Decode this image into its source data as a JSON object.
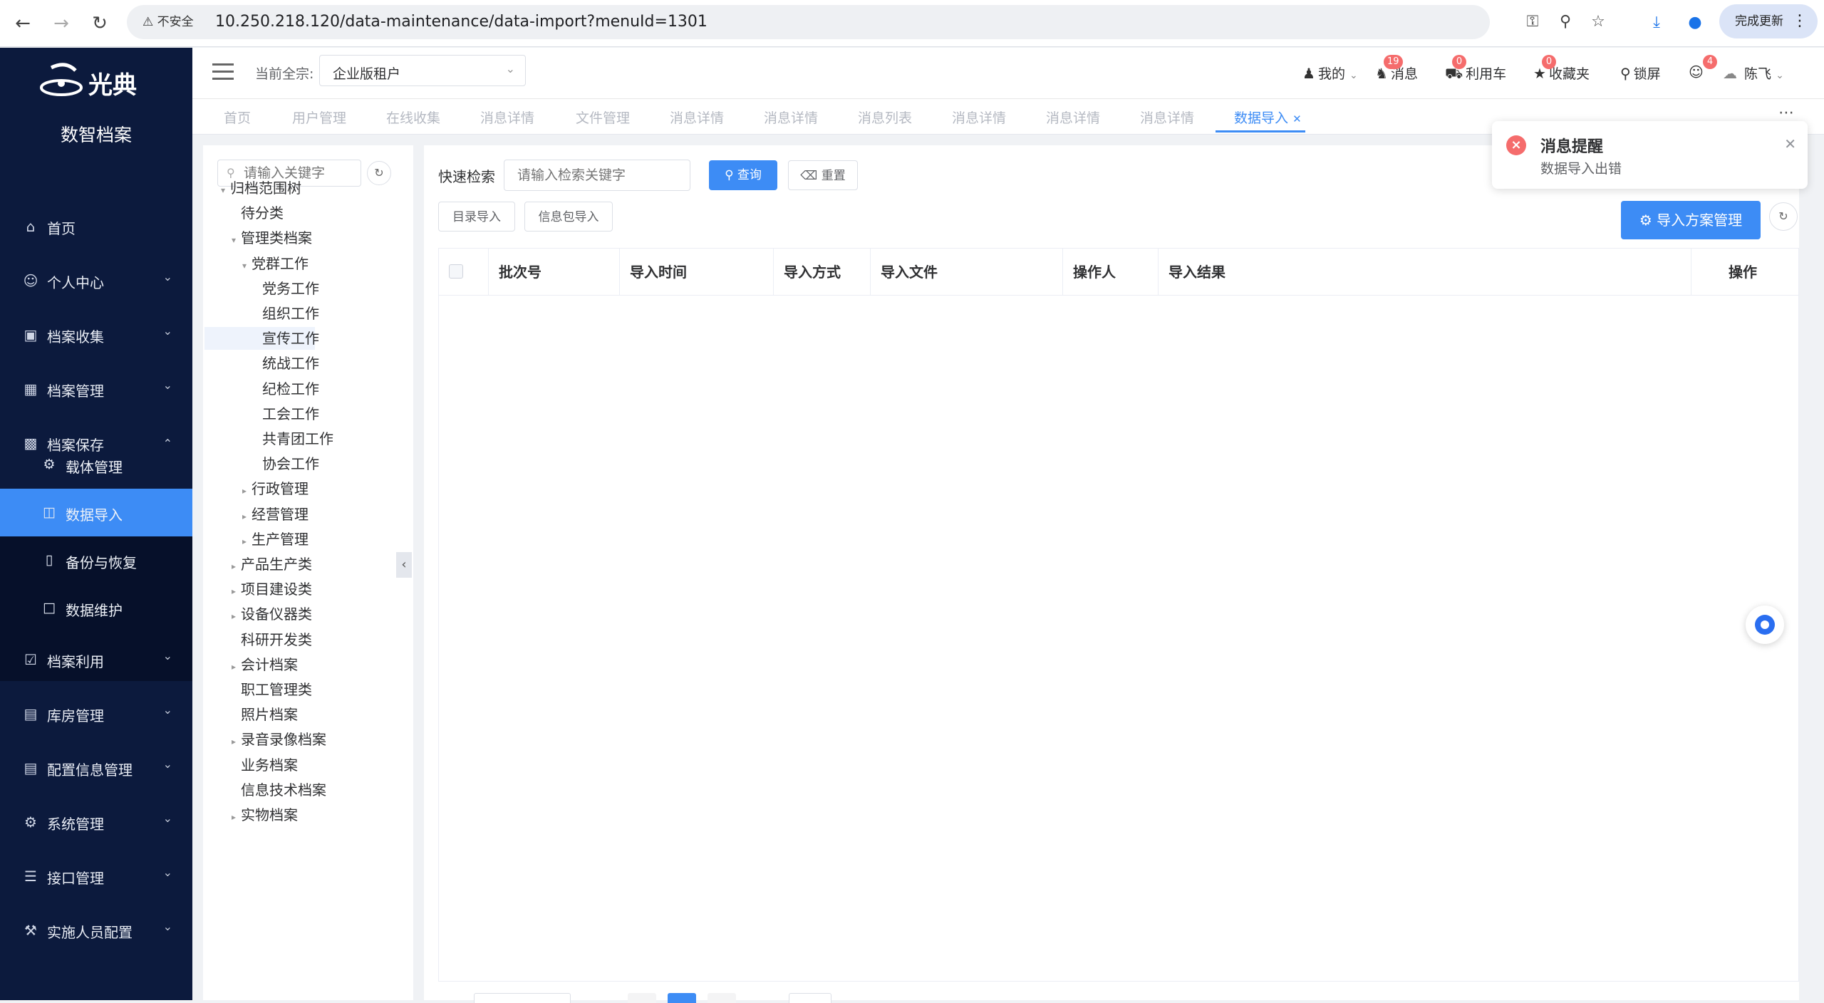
{
  "browser": {
    "security_label": "不安全",
    "url": "10.250.218.120/data-maintenance/data-import?menuId=1301",
    "update_label": "完成更新"
  },
  "sidebar": {
    "brand_logo_text": "光典",
    "brand_title": "数智档案",
    "menu": [
      {
        "label": "首页",
        "icon": "home-icon",
        "has_arrow": false
      },
      {
        "label": "个人中心",
        "icon": "user-icon",
        "has_arrow": true
      },
      {
        "label": "档案收集",
        "icon": "briefcase-icon",
        "has_arrow": true
      },
      {
        "label": "档案管理",
        "icon": "bank-icon",
        "has_arrow": true
      },
      {
        "label": "档案保存",
        "icon": "building-icon",
        "has_arrow": true,
        "expanded": true
      }
    ],
    "submenu": [
      {
        "label": "载体管理",
        "icon": "chip-icon"
      },
      {
        "label": "数据导入",
        "icon": "database-icon",
        "active": true
      },
      {
        "label": "备份与恢复",
        "icon": "tablet-icon"
      },
      {
        "label": "数据维护",
        "icon": "folder-icon"
      }
    ],
    "menu_after": [
      {
        "label": "档案利用",
        "icon": "clipboard-icon"
      },
      {
        "label": "库房管理",
        "icon": "warehouse-icon"
      },
      {
        "label": "配置信息管理",
        "icon": "file-icon"
      },
      {
        "label": "系统管理",
        "icon": "gear-icon"
      },
      {
        "label": "接口管理",
        "icon": "stack-icon"
      },
      {
        "label": "实施人员配置",
        "icon": "wrench-icon"
      }
    ]
  },
  "header": {
    "tenant_label": "当前全宗:",
    "tenant_value": "企业版租户",
    "mine": "我的",
    "messages": "消息",
    "messages_badge": "19",
    "cart": "利用车",
    "cart_badge": "0",
    "favorites": "收藏夹",
    "favorites_badge": "0",
    "lock": "锁屏",
    "online_badge": "4",
    "username": "陈飞"
  },
  "tabs": [
    "首页",
    "用户管理",
    "在线收集",
    "消息详情",
    "文件管理",
    "消息详情",
    "消息详情",
    "消息列表",
    "消息详情",
    "消息详情",
    "消息详情",
    "数据导入"
  ],
  "tree": {
    "search_placeholder": "请输入关键字",
    "nodes": [
      {
        "label": "归档范围树",
        "level": 0,
        "caret": "down"
      },
      {
        "label": "待分类",
        "level": 1,
        "caret": ""
      },
      {
        "label": "管理类档案",
        "level": 1,
        "caret": "down"
      },
      {
        "label": "党群工作",
        "level": 2,
        "caret": "down"
      },
      {
        "label": "党务工作",
        "level": 3,
        "caret": ""
      },
      {
        "label": "组织工作",
        "level": 3,
        "caret": ""
      },
      {
        "label": "宣传工作",
        "level": 3,
        "caret": "",
        "selected": true
      },
      {
        "label": "统战工作",
        "level": 3,
        "caret": ""
      },
      {
        "label": "纪检工作",
        "level": 3,
        "caret": ""
      },
      {
        "label": "工会工作",
        "level": 3,
        "caret": ""
      },
      {
        "label": "共青团工作",
        "level": 3,
        "caret": ""
      },
      {
        "label": "协会工作",
        "level": 3,
        "caret": ""
      },
      {
        "label": "行政管理",
        "level": 2,
        "caret": "right"
      },
      {
        "label": "经营管理",
        "level": 2,
        "caret": "right"
      },
      {
        "label": "生产管理",
        "level": 2,
        "caret": "right"
      },
      {
        "label": "产品生产类",
        "level": 1,
        "caret": "right"
      },
      {
        "label": "项目建设类",
        "level": 1,
        "caret": "right"
      },
      {
        "label": "设备仪器类",
        "level": 1,
        "caret": "right"
      },
      {
        "label": "科研开发类",
        "level": 1,
        "caret": ""
      },
      {
        "label": "会计档案",
        "level": 1,
        "caret": "right"
      },
      {
        "label": "职工管理类",
        "level": 1,
        "caret": ""
      },
      {
        "label": "照片档案",
        "level": 1,
        "caret": ""
      },
      {
        "label": "录音录像档案",
        "level": 1,
        "caret": "right"
      },
      {
        "label": "业务档案",
        "level": 1,
        "caret": ""
      },
      {
        "label": "信息技术档案",
        "level": 1,
        "caret": ""
      },
      {
        "label": "实物档案",
        "level": 1,
        "caret": "right"
      }
    ]
  },
  "main": {
    "quick_search_label": "快速检索",
    "search_placeholder": "请输入检索关键字",
    "query_btn": "查询",
    "reset_btn": "重置",
    "catalog_import_btn": "目录导入",
    "package_import_btn": "信息包导入",
    "scheme_btn": "导入方案管理",
    "columns": [
      "批次号",
      "导入时间",
      "导入方式",
      "导入文件",
      "操作人",
      "导入结果",
      "操作"
    ]
  },
  "notification": {
    "title": "消息提醒",
    "message": "数据导入出错"
  },
  "colors": {
    "accent": "#3d8cf5",
    "sidebar_bg": "#0c1a3d",
    "error": "#f56c6c"
  }
}
